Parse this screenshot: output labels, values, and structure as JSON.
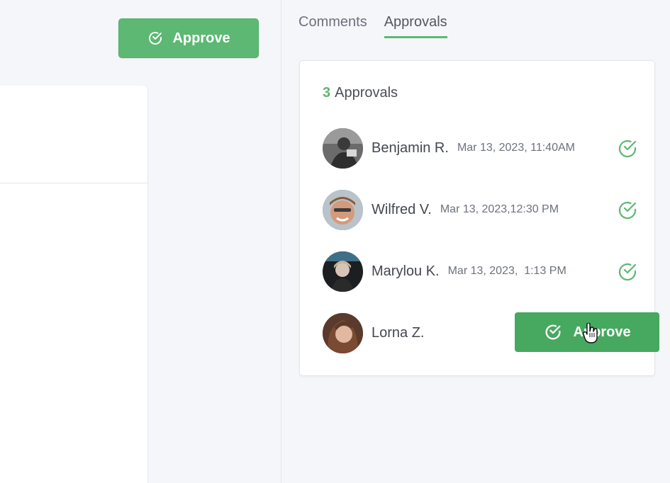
{
  "toolbar": {
    "approve_label": "Approve"
  },
  "tabs": [
    {
      "label": "Comments",
      "active": false
    },
    {
      "label": "Approvals",
      "active": true
    }
  ],
  "approvals": {
    "count": "3",
    "title_suffix": "Approvals",
    "rows": [
      {
        "name": "Benjamin R.",
        "date": "Mar 13, 2023, 11:40AM",
        "approved": true,
        "icon": "check-circle-icon"
      },
      {
        "name": "Wilfred V.",
        "date": "Mar 13, 2023,12:30 PM",
        "approved": true,
        "icon": "check-circle-icon"
      },
      {
        "name": "Marylou K.",
        "date": "Mar 13, 2023,  1:13 PM",
        "approved": true,
        "icon": "check-circle-icon"
      },
      {
        "name": "Lorna Z.",
        "date": "",
        "approved": false,
        "button_label": "Approve"
      }
    ]
  },
  "colors": {
    "accent": "#5cb872",
    "accent_dark": "#47a85f",
    "background": "#f5f6fa",
    "card": "#ffffff"
  }
}
